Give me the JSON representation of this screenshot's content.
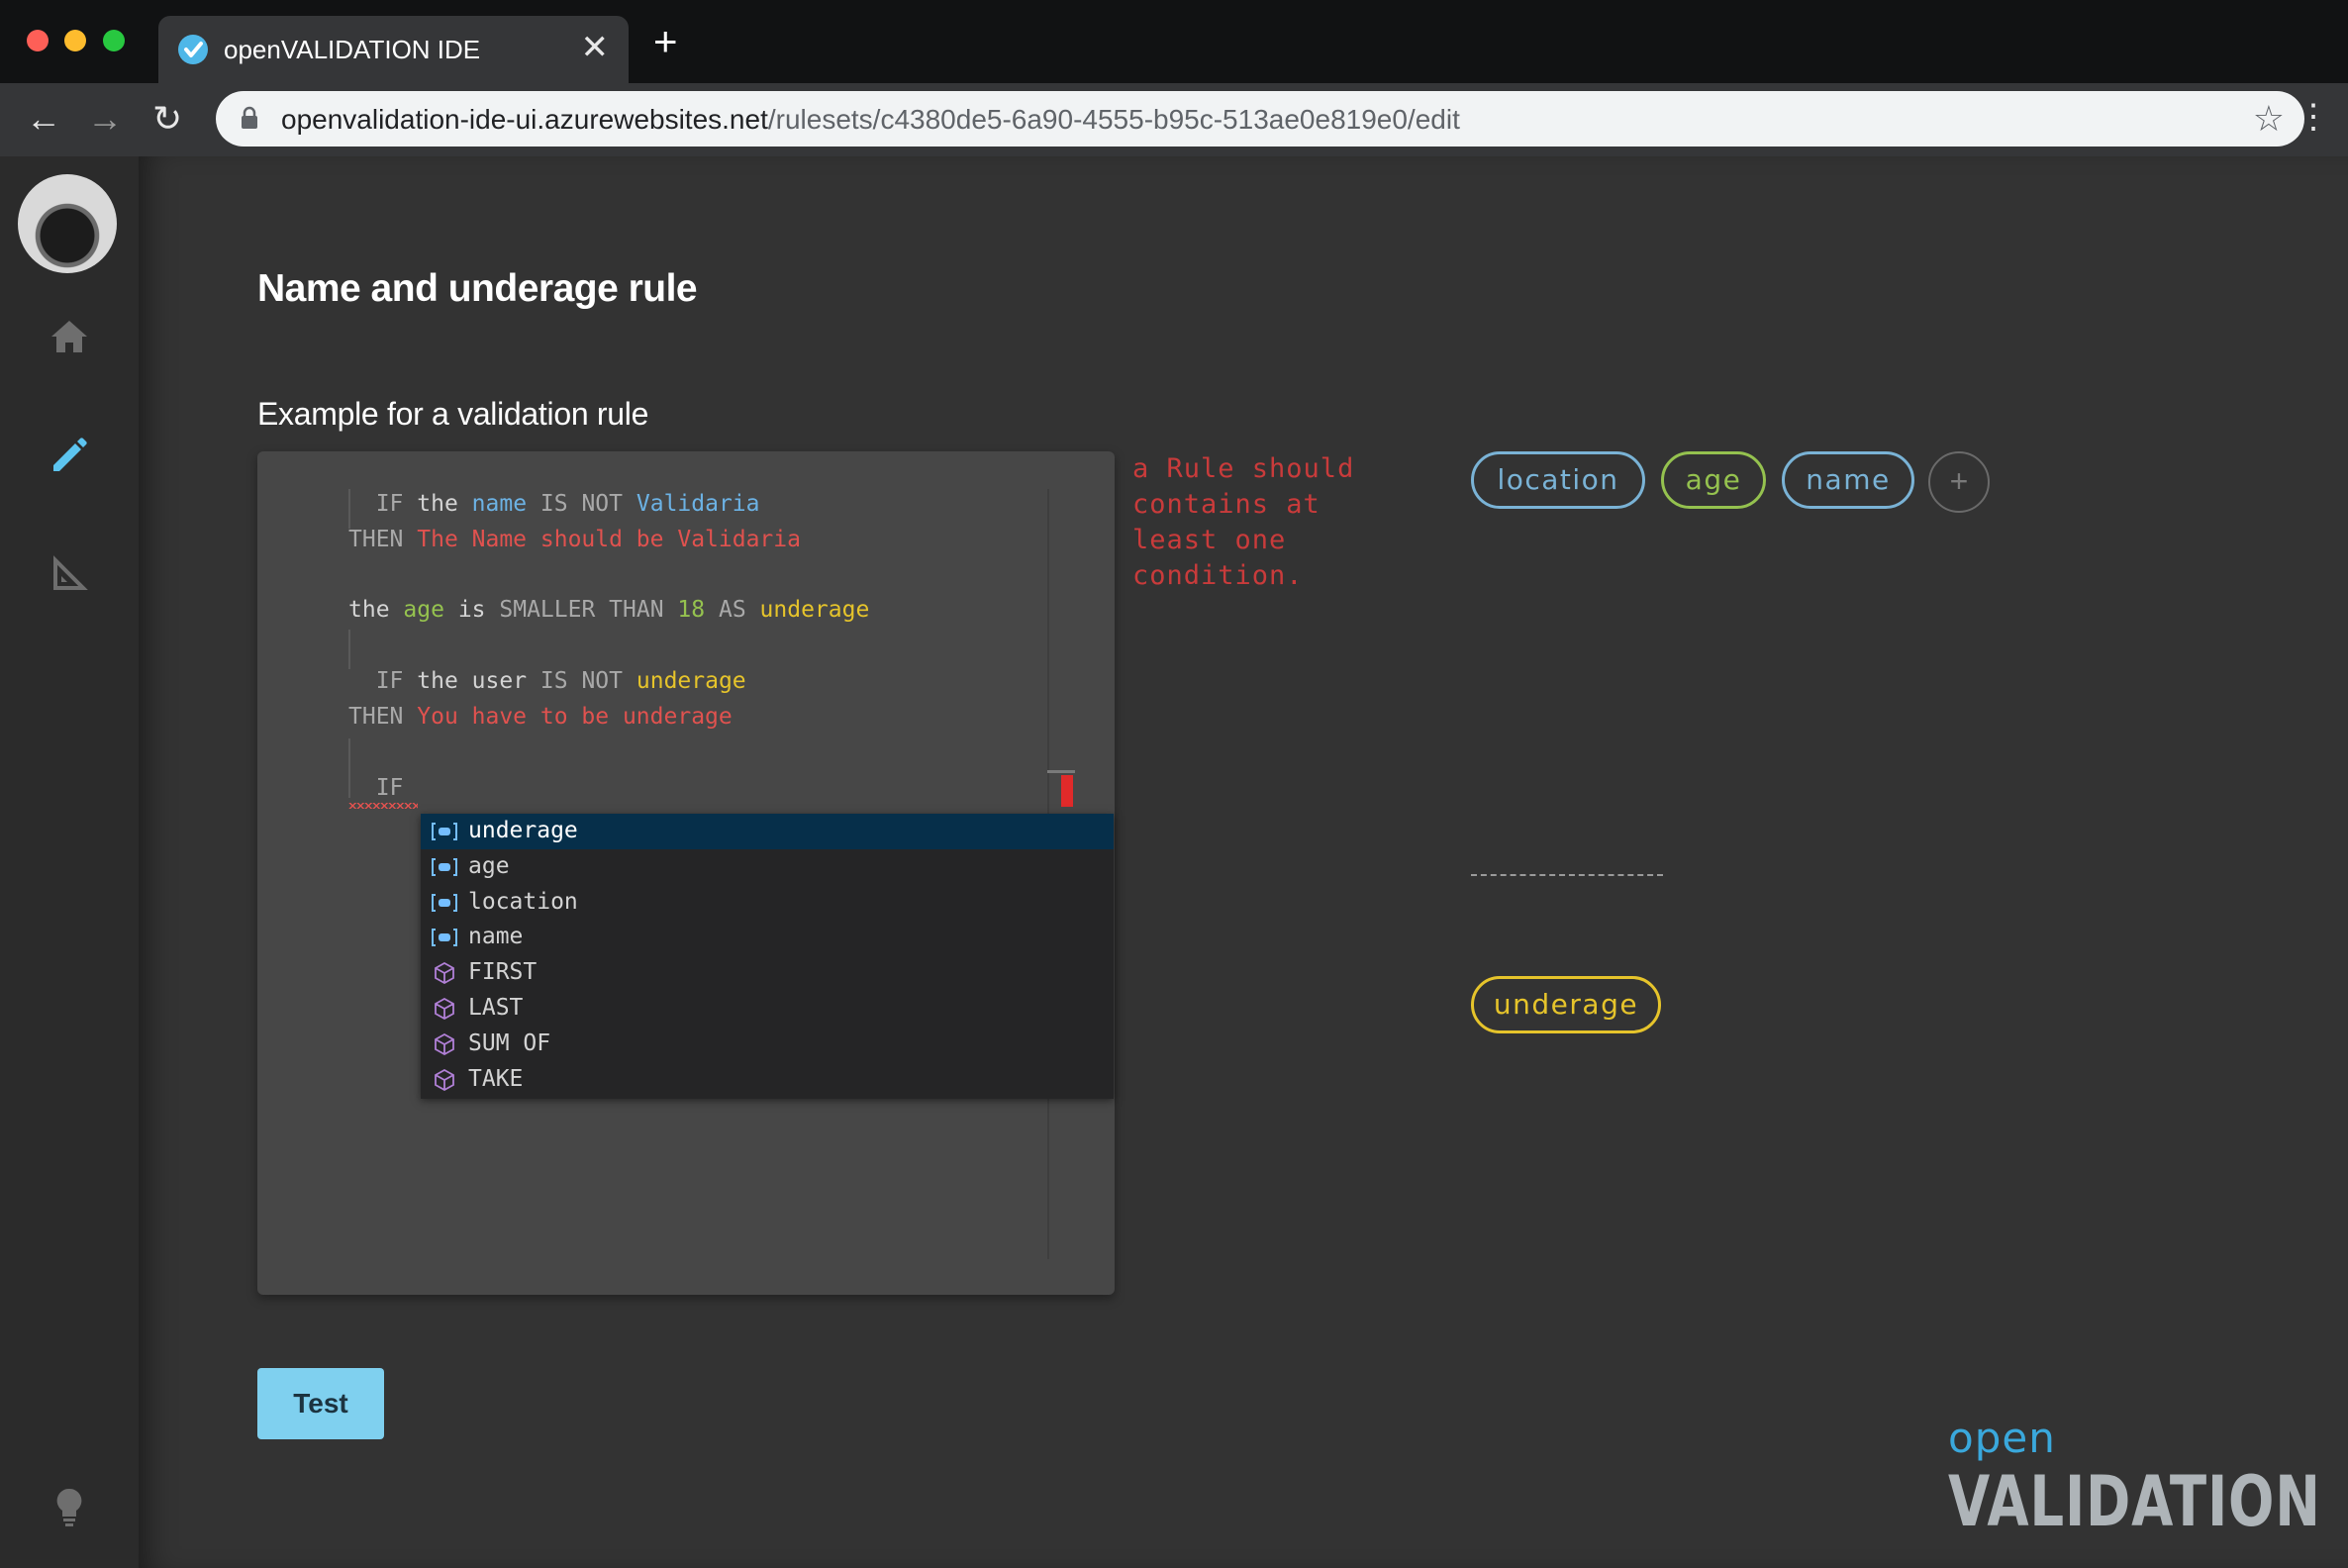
{
  "browser": {
    "tab_title": "openVALIDATION IDE",
    "tab_close": "✕",
    "new_tab": "+",
    "url_host": "openvalidation-ide-ui.azurewebsites.net",
    "url_path": "/rulesets/c4380de5-6a90-4555-b95c-513ae0e819e0/edit",
    "back": "←",
    "forward": "→",
    "reload": "↻",
    "star": "☆",
    "menu": "⋮"
  },
  "sidebar": {
    "items": [
      {
        "name": "home-icon"
      },
      {
        "name": "pencil-icon",
        "active": true,
        "color": "#5cc4f0"
      },
      {
        "name": "ruler-icon"
      },
      {
        "name": "lightbulb-icon"
      }
    ]
  },
  "main": {
    "page_title": "Name and underage rule",
    "section_title": "Example for a validation rule",
    "error_message": "a Rule should contains at least one condition.",
    "test_button": "Test"
  },
  "editor": {
    "lines": [
      {
        "parts": [
          "IF",
          "the",
          "name",
          "IS NOT",
          "Validaria"
        ]
      },
      {
        "parts": [
          "THEN",
          "The Name should be Validaria"
        ]
      },
      {
        "parts": [
          "the",
          "age",
          "is",
          "SMALLER THAN",
          "18",
          "AS",
          "underage"
        ]
      },
      {
        "parts": [
          "IF",
          "the",
          "user",
          "IS NOT",
          "underage"
        ]
      },
      {
        "parts": [
          "THEN",
          "You have to be underage"
        ]
      },
      {
        "parts": [
          "IF"
        ]
      }
    ],
    "suggestions": [
      {
        "label": "underage",
        "kind": "variable",
        "selected": true
      },
      {
        "label": "age",
        "kind": "variable"
      },
      {
        "label": "location",
        "kind": "variable"
      },
      {
        "label": "name",
        "kind": "variable"
      },
      {
        "label": "FIRST",
        "kind": "module"
      },
      {
        "label": "LAST",
        "kind": "module"
      },
      {
        "label": "SUM OF",
        "kind": "module"
      },
      {
        "label": "TAKE",
        "kind": "module"
      }
    ]
  },
  "schema_chips": [
    {
      "label": "location",
      "color": "#7ab3d6"
    },
    {
      "label": "age",
      "color": "#95c24f"
    },
    {
      "label": "name",
      "color": "#7ab3d6"
    }
  ],
  "add_chip": "+",
  "variable_chips": [
    {
      "label": "underage",
      "color": "#e6c42b"
    }
  ],
  "logo": {
    "top": "open",
    "word": "VALIDATION"
  }
}
